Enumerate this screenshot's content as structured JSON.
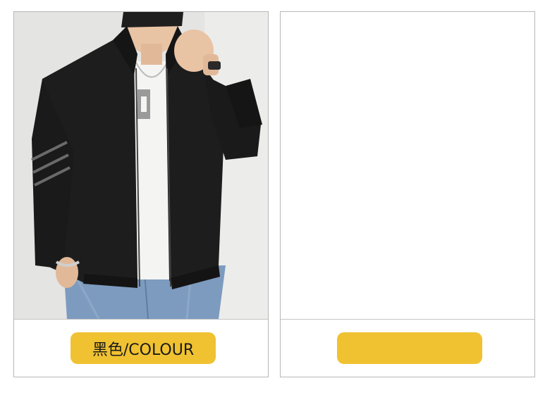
{
  "products": [
    {
      "image": "man-in-black-zip-jacket-photo",
      "color_label": "黑色/COLOUR"
    },
    {
      "image": "",
      "color_label": ""
    }
  ],
  "colors": {
    "accent": "#f0c231",
    "border": "#b8b8b8",
    "background": "#ffffff"
  }
}
